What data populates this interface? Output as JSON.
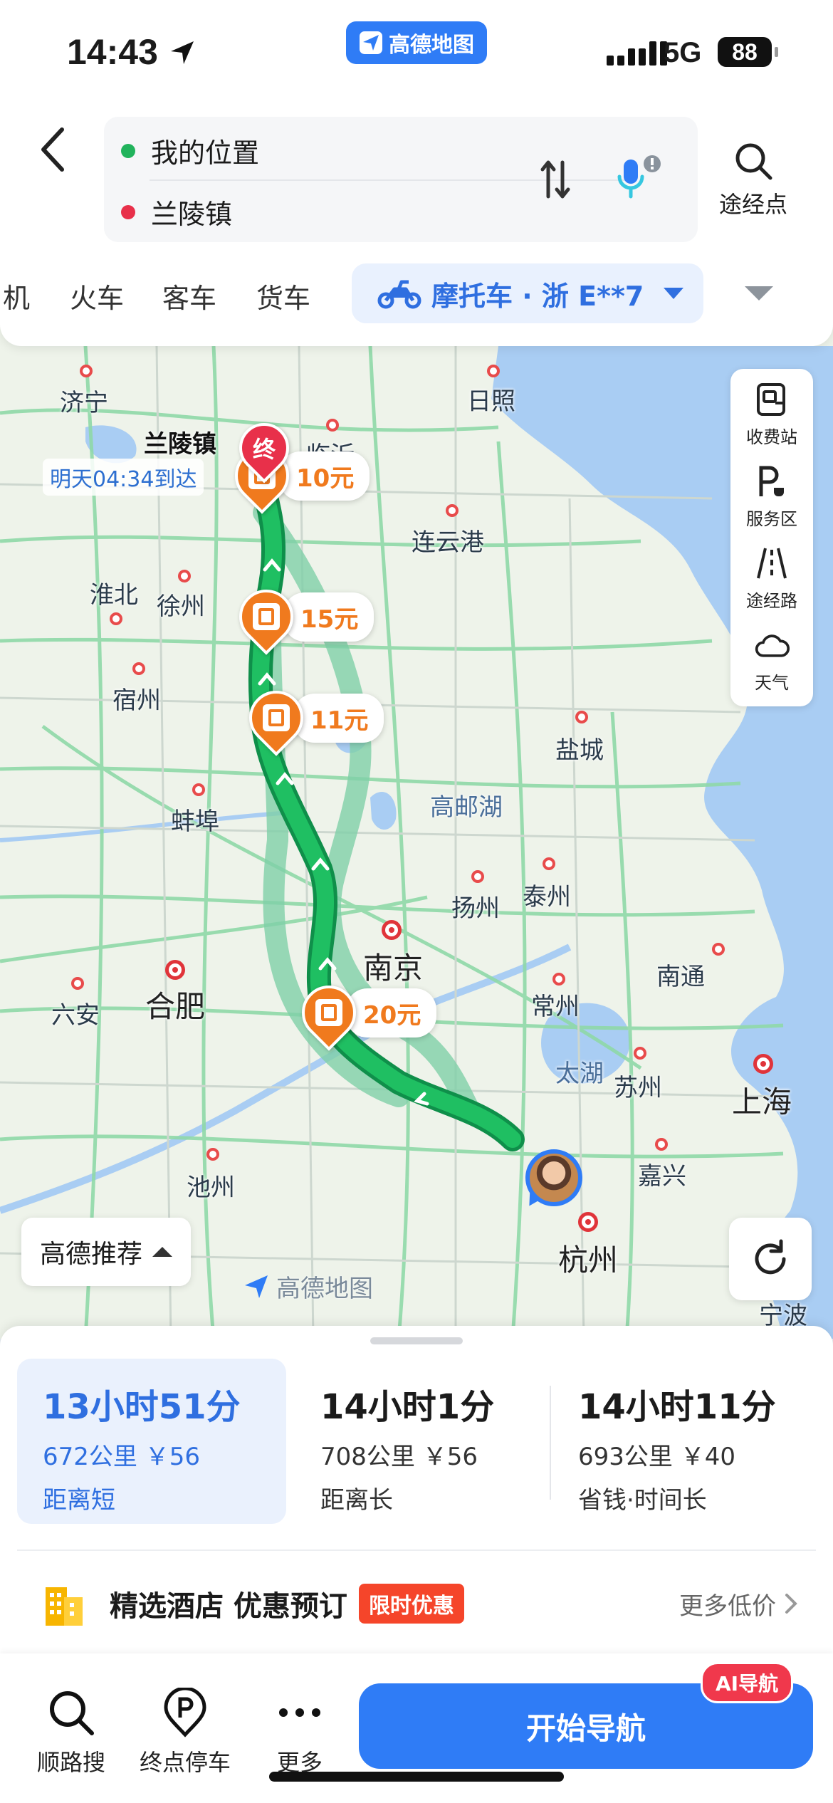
{
  "status_bar": {
    "time": "14:43",
    "network": "5G",
    "battery": "88",
    "app_badge": "高德地图"
  },
  "route_input": {
    "origin": "我的位置",
    "destination": "兰陵镇",
    "via_label": "途经点"
  },
  "mode_tabs": {
    "items": [
      "机",
      "火车",
      "客车",
      "货车"
    ],
    "active": "摩托车 · 浙 E**7"
  },
  "map": {
    "cities": [
      "济宁",
      "日照",
      "兰陵镇",
      "临沂",
      "连云港",
      "淮北",
      "徐州",
      "宿州",
      "盐城",
      "蚌埠",
      "高邮湖",
      "扬州",
      "泰州",
      "南京",
      "南通",
      "合肥",
      "六安",
      "常州",
      "太湖",
      "苏州",
      "上海",
      "池州",
      "嘉兴",
      "杭州",
      "宁波"
    ],
    "arrival_label": "明天04:34到达",
    "end_marker": "终",
    "toll_fees": [
      "10元",
      "15元",
      "11元",
      "20元"
    ],
    "side_tools": [
      "收费站",
      "服务区",
      "途经路",
      "天气"
    ],
    "recommend_label": "高德推荐",
    "logo_text": "高德地图"
  },
  "plans": [
    {
      "duration": "13小时51分",
      "detail": "672公里 ￥56",
      "tag": "距离短"
    },
    {
      "duration": "14小时1分",
      "detail": "708公里 ￥56",
      "tag": "距离长"
    },
    {
      "duration": "14小时11分",
      "detail": "693公里 ￥40",
      "tag": "省钱·时间长"
    }
  ],
  "hotel": {
    "title": "精选酒店 优惠预订",
    "badge": "限时优惠",
    "more": "更多低价"
  },
  "actions": {
    "search_along": "顺路搜",
    "parking": "终点停车",
    "more": "更多",
    "start_nav": "开始导航",
    "ai_badge": "AI导航"
  },
  "colors": {
    "accent": "#2f7cf6",
    "route": "#1fae5e",
    "toll": "#f07a1e",
    "end": "#e8304a"
  }
}
